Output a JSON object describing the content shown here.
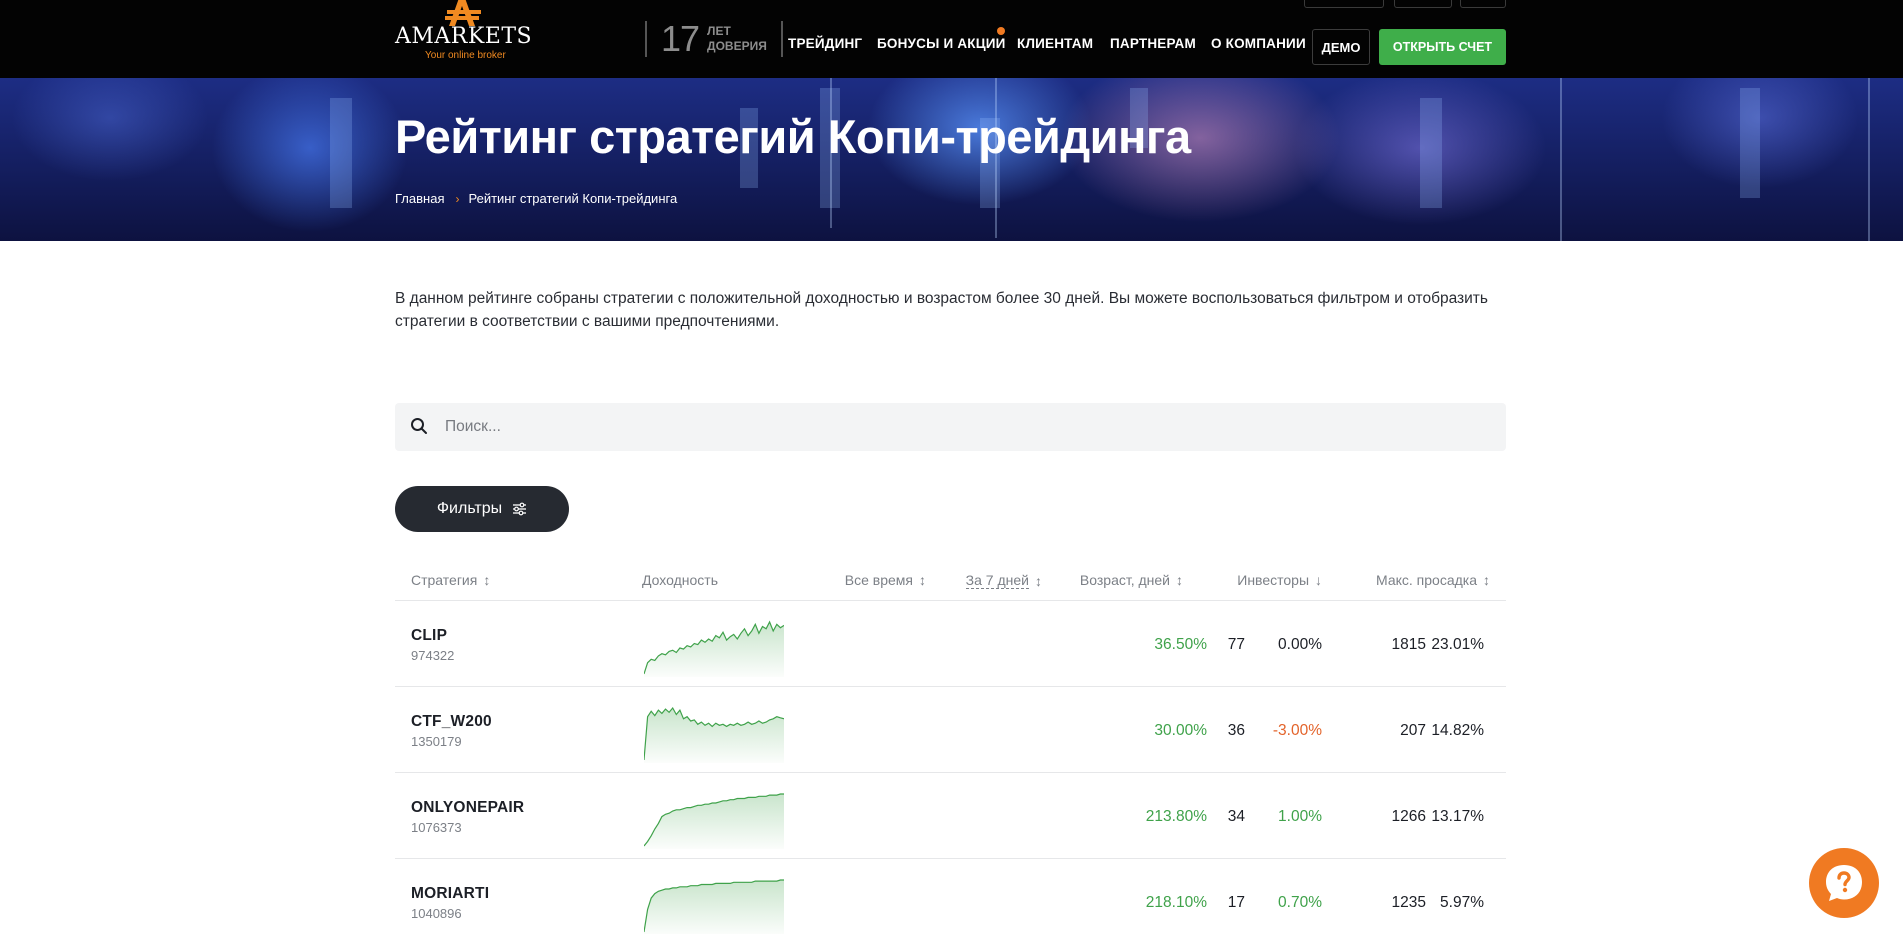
{
  "header": {
    "logo_word": "AMARKETS",
    "logo_tagline": "Your online broker",
    "years_number": "17",
    "years_label_line1": "ЛЕТ",
    "years_label_line2": "ДОВЕРИЯ",
    "nav": [
      {
        "label": "ТРЕЙДИНГ"
      },
      {
        "label": "БОНУСЫ И АКЦИИ"
      },
      {
        "label": "КЛИЕНТАМ"
      },
      {
        "label": "ПАРТНЕРАМ"
      },
      {
        "label": "О КОМПАНИИ"
      }
    ],
    "demo_label": "ДЕМО",
    "open_account_label": "ОТКРЫТЬ СЧЕТ",
    "colors": {
      "accent": "#f08a21",
      "cta": "#3fae4a",
      "notice_dot": "#f07a22"
    }
  },
  "hero": {
    "title": "Рейтинг стратегий Копи-трейдинга",
    "breadcrumbs": [
      {
        "label": "Главная"
      },
      {
        "label": "Рейтинг стратегий Копи-трейдинга"
      }
    ]
  },
  "intro": "В данном рейтинге собраны стратегии с положительной доходностью и возрастом более 30 дней. Вы можете воспользоваться фильтром и отобразить стратегии в соответствии с вашими предпочтениями.",
  "search": {
    "placeholder": "Поиск...",
    "value": "",
    "icon": "search-icon"
  },
  "filters_label": "Фильтры",
  "table": {
    "columns": [
      {
        "label": "Стратегия",
        "sort": "both"
      },
      {
        "label": "Доходность",
        "sort": "none"
      },
      {
        "label": "Все время",
        "sort": "both"
      },
      {
        "label": "За 7 дней",
        "sort": "both"
      },
      {
        "label": "Возраст, дней",
        "sort": "both"
      },
      {
        "label": "Инвесторы",
        "sort": "desc"
      },
      {
        "label": "Макс. просадка",
        "sort": "both"
      }
    ],
    "rows": [
      {
        "name": "CLIP",
        "id": "974322",
        "all_time": "36.50%",
        "week": "0.00%",
        "week_trend": "neutral",
        "age": "1815",
        "investors": "77",
        "drawdown": "23.01%",
        "spark": [
          0,
          10,
          13,
          12,
          16,
          18,
          17,
          20,
          21,
          19,
          23,
          22,
          25,
          24,
          27,
          26,
          30,
          28,
          31,
          29,
          34,
          32,
          37,
          30,
          33,
          35,
          31,
          36,
          40,
          34,
          38,
          44,
          36,
          42,
          40,
          46,
          38,
          44,
          41,
          43
        ]
      },
      {
        "name": "CTF_W200",
        "id": "1350179",
        "all_time": "30.00%",
        "week": "-3.00%",
        "week_trend": "negative",
        "age": "207",
        "investors": "36",
        "drawdown": "14.82%",
        "spark": [
          0,
          40,
          45,
          41,
          46,
          43,
          47,
          44,
          48,
          42,
          46,
          38,
          40,
          36,
          37,
          33,
          35,
          32,
          34,
          31,
          34,
          32,
          33,
          31,
          33,
          32,
          34,
          32,
          33,
          35,
          33,
          34,
          36,
          34,
          35,
          37,
          38,
          40,
          39,
          38
        ]
      },
      {
        "name": "ONLYONEPAIR",
        "id": "1076373",
        "all_time": "213.80%",
        "week": "1.00%",
        "week_trend": "positive",
        "age": "1266",
        "investors": "34",
        "drawdown": "13.17%",
        "spark": [
          0,
          4,
          9,
          15,
          20,
          26,
          28,
          29,
          31,
          32,
          32,
          33,
          34,
          34,
          35,
          36,
          36,
          37,
          37,
          38,
          38,
          39,
          40,
          40,
          41,
          41,
          42,
          42,
          42,
          43,
          43,
          43,
          44,
          44,
          44,
          45,
          45,
          45,
          46,
          46
        ]
      },
      {
        "name": "MORIARTI",
        "id": "1040896",
        "all_time": "218.10%",
        "week": "0.70%",
        "week_trend": "positive",
        "age": "1235",
        "investors": "17",
        "drawdown": "5.97%",
        "spark": [
          0,
          20,
          30,
          34,
          36,
          37,
          38,
          38,
          39,
          39,
          40,
          40,
          40,
          41,
          41,
          41,
          42,
          42,
          42,
          42,
          43,
          43,
          43,
          43,
          43,
          44,
          44,
          44,
          44,
          44,
          44,
          45,
          45,
          45,
          45,
          45,
          45,
          45,
          46,
          46
        ]
      }
    ]
  },
  "help_button": {
    "icon": "chat-help-icon"
  }
}
